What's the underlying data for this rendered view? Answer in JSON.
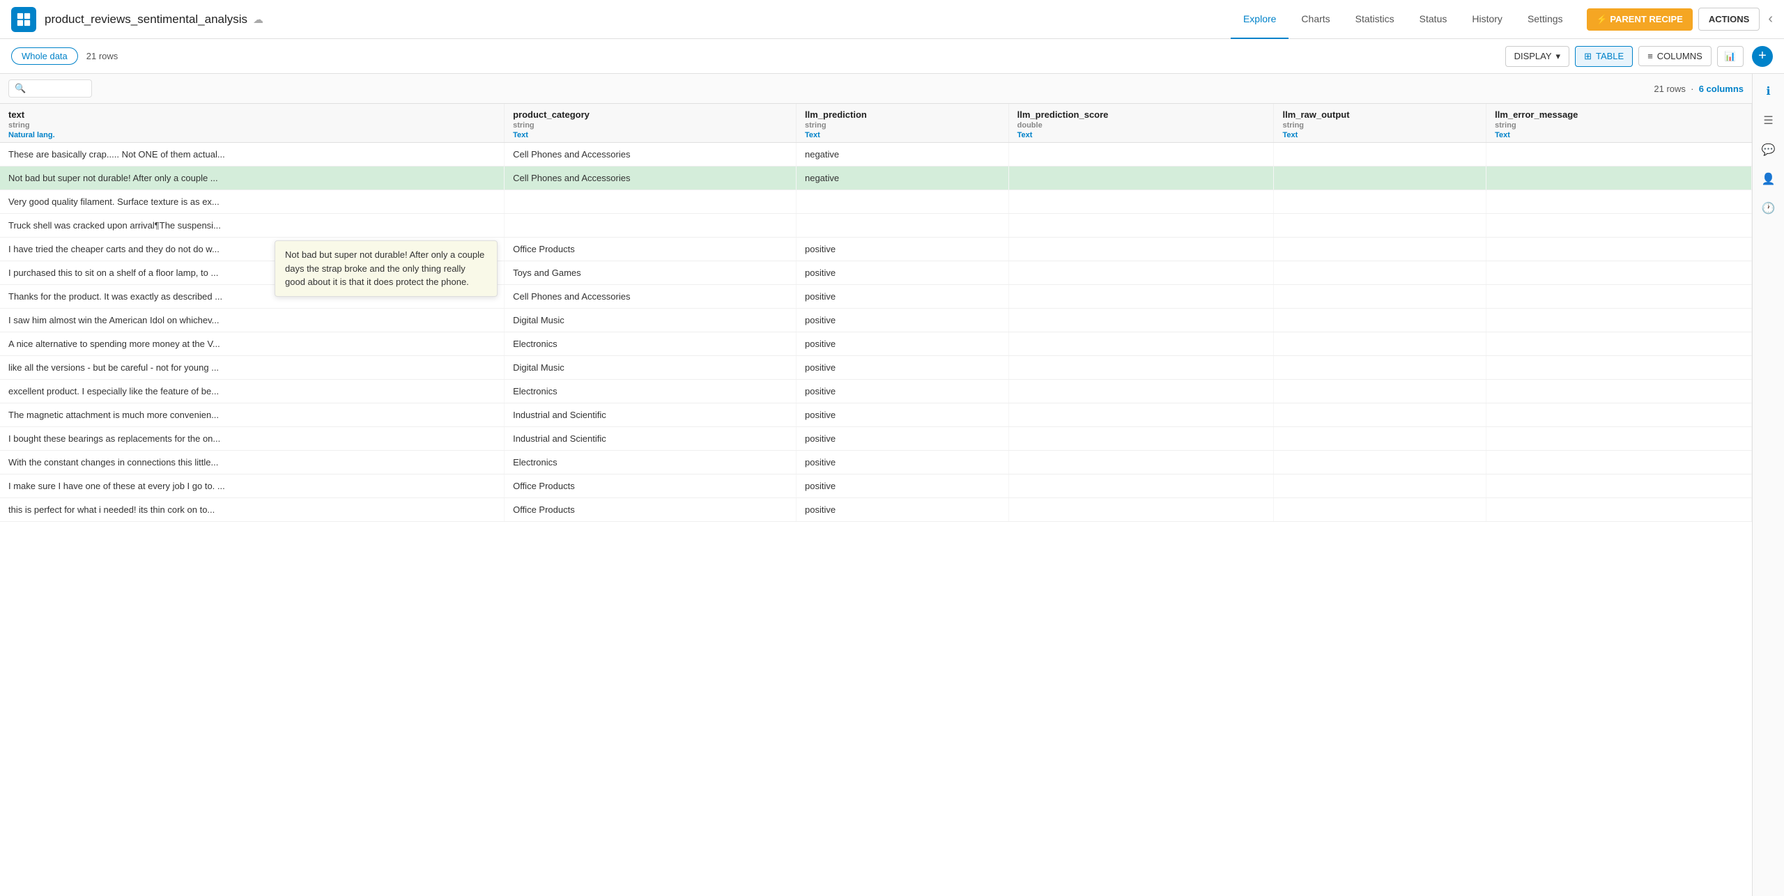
{
  "app": {
    "title": "product_reviews_sentimental_analysis",
    "logo_icon": "grid-icon"
  },
  "nav": {
    "tabs": [
      {
        "label": "Explore",
        "active": true
      },
      {
        "label": "Charts",
        "active": false
      },
      {
        "label": "Statistics",
        "active": false
      },
      {
        "label": "Status",
        "active": false
      },
      {
        "label": "History",
        "active": false
      },
      {
        "label": "Settings",
        "active": false
      }
    ],
    "parent_recipe_btn": "⚡ PARENT RECIPE",
    "actions_btn": "ACTIONS"
  },
  "subtoolbar": {
    "whole_data": "Whole data",
    "rows_label": "21 rows",
    "display_btn": "DISPLAY",
    "table_btn": "TABLE",
    "columns_btn": "COLUMNS"
  },
  "search": {
    "placeholder": "",
    "rows_info": "21 rows",
    "cols_info": "6 columns"
  },
  "columns": [
    {
      "name": "text",
      "type": "string",
      "subtype": "Natural lang.",
      "link_text": "Natural lang."
    },
    {
      "name": "product_category",
      "type": "string",
      "subtype": "",
      "link_text": "Text"
    },
    {
      "name": "llm_prediction",
      "type": "string",
      "subtype": "",
      "link_text": "Text"
    },
    {
      "name": "llm_prediction_score",
      "type": "double",
      "subtype": "",
      "link_text": "Text"
    },
    {
      "name": "llm_raw_output",
      "type": "string",
      "subtype": "",
      "link_text": "Text"
    },
    {
      "name": "llm_error_message",
      "type": "string",
      "subtype": "",
      "link_text": "Text"
    }
  ],
  "rows": [
    {
      "text": "These are basically crap..... Not ONE of them actual...",
      "product_category": "Cell Phones and Accessories",
      "llm_prediction": "negative",
      "llm_prediction_score": "",
      "llm_raw_output": "",
      "llm_error_message": "",
      "highlighted": false
    },
    {
      "text": "Not bad but super not durable! After only a couple ...",
      "product_category": "Cell Phones and Accessories",
      "llm_prediction": "negative",
      "llm_prediction_score": "",
      "llm_raw_output": "",
      "llm_error_message": "",
      "highlighted": true
    },
    {
      "text": "Very good quality filament. Surface texture is as ex...",
      "product_category": "",
      "llm_prediction": "",
      "llm_prediction_score": "",
      "llm_raw_output": "",
      "llm_error_message": ""
    },
    {
      "text": "Truck shell was cracked upon arrival¶The suspensi...",
      "product_category": "",
      "llm_prediction": "",
      "llm_prediction_score": "",
      "llm_raw_output": "",
      "llm_error_message": ""
    },
    {
      "text": "I have tried the cheaper carts and they do not do w...",
      "product_category": "Office Products",
      "llm_prediction": "positive",
      "llm_prediction_score": "",
      "llm_raw_output": "",
      "llm_error_message": ""
    },
    {
      "text": "I purchased this to sit on a shelf of a floor lamp, to ...",
      "product_category": "Toys and Games",
      "llm_prediction": "positive",
      "llm_prediction_score": "",
      "llm_raw_output": "",
      "llm_error_message": ""
    },
    {
      "text": "Thanks for the product. It was exactly as described ...",
      "product_category": "Cell Phones and Accessories",
      "llm_prediction": "positive",
      "llm_prediction_score": "",
      "llm_raw_output": "",
      "llm_error_message": ""
    },
    {
      "text": "I saw him almost win the American Idol on whichev...",
      "product_category": "Digital Music",
      "llm_prediction": "positive",
      "llm_prediction_score": "",
      "llm_raw_output": "",
      "llm_error_message": ""
    },
    {
      "text": "A nice alternative to spending more money at the V...",
      "product_category": "Electronics",
      "llm_prediction": "positive",
      "llm_prediction_score": "",
      "llm_raw_output": "",
      "llm_error_message": ""
    },
    {
      "text": "like all the versions - but be careful - not for young ...",
      "product_category": "Digital Music",
      "llm_prediction": "positive",
      "llm_prediction_score": "",
      "llm_raw_output": "",
      "llm_error_message": ""
    },
    {
      "text": "excellent product.  I especially like the feature of be...",
      "product_category": "Electronics",
      "llm_prediction": "positive",
      "llm_prediction_score": "",
      "llm_raw_output": "",
      "llm_error_message": ""
    },
    {
      "text": "The magnetic attachment is much more convenien...",
      "product_category": "Industrial and Scientific",
      "llm_prediction": "positive",
      "llm_prediction_score": "",
      "llm_raw_output": "",
      "llm_error_message": ""
    },
    {
      "text": "I bought these bearings as replacements for the on...",
      "product_category": "Industrial and Scientific",
      "llm_prediction": "positive",
      "llm_prediction_score": "",
      "llm_raw_output": "",
      "llm_error_message": ""
    },
    {
      "text": "With the constant changes in connections this little...",
      "product_category": "Electronics",
      "llm_prediction": "positive",
      "llm_prediction_score": "",
      "llm_raw_output": "",
      "llm_error_message": ""
    },
    {
      "text": "I make sure I have one of these at every job I go to. ...",
      "product_category": "Office Products",
      "llm_prediction": "positive",
      "llm_prediction_score": "",
      "llm_raw_output": "",
      "llm_error_message": ""
    },
    {
      "text": "this is perfect for what i needed! its thin cork on to...",
      "product_category": "Office Products",
      "llm_prediction": "positive",
      "llm_prediction_score": "",
      "llm_raw_output": "",
      "llm_error_message": ""
    }
  ],
  "tooltip": {
    "text": "Not bad but super not durable! After only a couple days the strap broke and the only thing really good about it is that it does protect the phone."
  },
  "right_sidebar_icons": [
    {
      "name": "info-icon",
      "symbol": "ℹ"
    },
    {
      "name": "menu-icon",
      "symbol": "☰"
    },
    {
      "name": "chat-icon",
      "symbol": "💬"
    },
    {
      "name": "user-icon",
      "symbol": "👤"
    },
    {
      "name": "clock-icon",
      "symbol": "🕐"
    }
  ]
}
